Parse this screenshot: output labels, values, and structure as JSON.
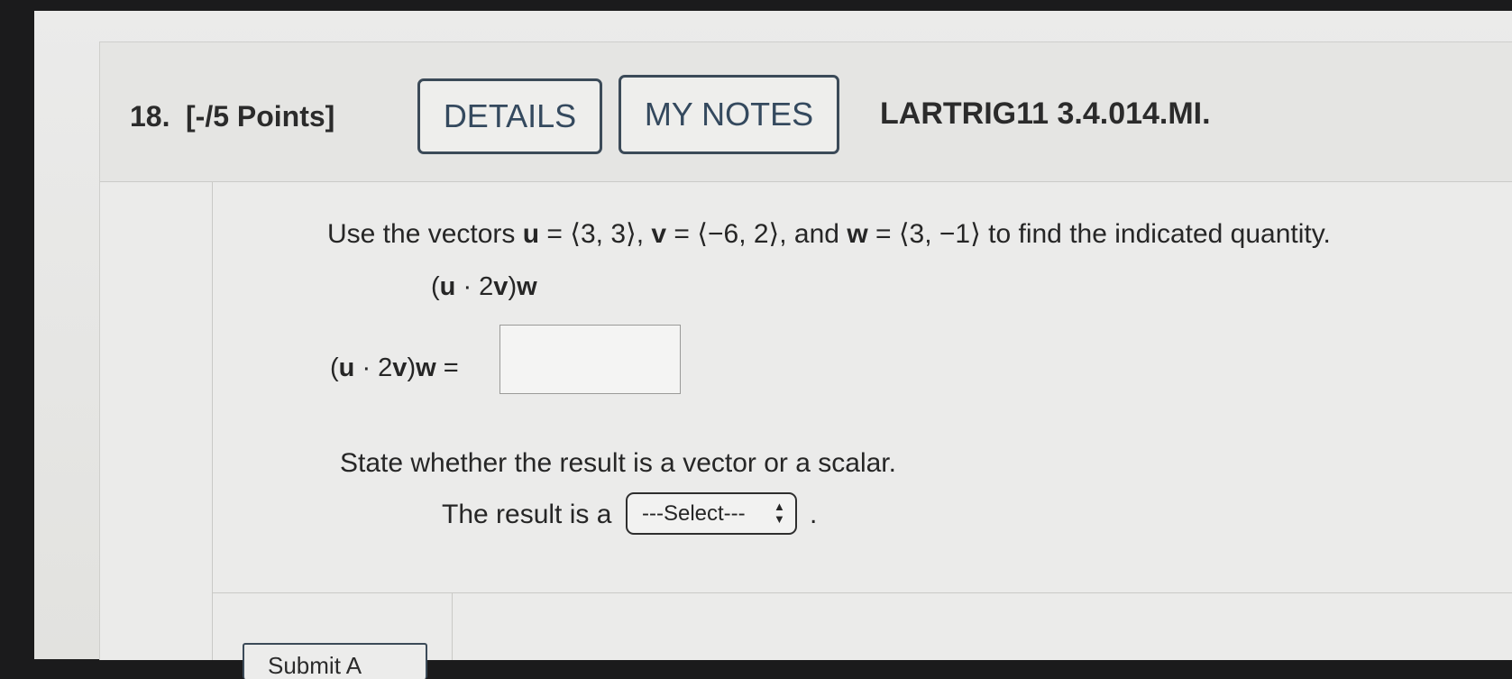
{
  "question": {
    "number": "18.",
    "points": "[-/5 Points]",
    "details_label": "DETAILS",
    "my_notes_label": "MY NOTES",
    "code": "LARTRIG11 3.4.014.MI."
  },
  "prompt": {
    "t1": "Use the vectors ",
    "u": "u",
    "t2": " = ⟨3, 3⟩, ",
    "v": "v",
    "t3": " = ⟨−6, 2⟩, and ",
    "w": "w",
    "t4": " = ⟨3, −1⟩ to find the indicated quantity."
  },
  "expression": {
    "open": "(",
    "u": "u",
    "mid": " · 2",
    "v": "v",
    "close": ")",
    "w": "w"
  },
  "answer": {
    "eq": " =",
    "value": ""
  },
  "state_question": "State whether the result is a vector or a scalar.",
  "result": {
    "prefix": "The result is a",
    "select_value": "---Select---",
    "suffix": "."
  },
  "submit": {
    "label": "Submit A"
  }
}
